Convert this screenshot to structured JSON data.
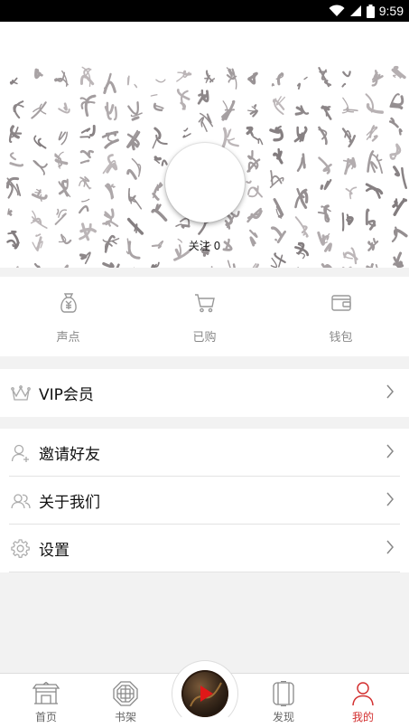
{
  "status_bar": {
    "time": "9:59",
    "icons": [
      "wifi-icon",
      "cell-signal-icon",
      "battery-icon"
    ]
  },
  "profile": {
    "follow_text": "关注 0"
  },
  "quick_menu": [
    {
      "label": "声点",
      "icon": "coin-bag-icon"
    },
    {
      "label": "已购",
      "icon": "cart-icon"
    },
    {
      "label": "钱包",
      "icon": "wallet-icon"
    }
  ],
  "vip_section": {
    "vip_label": "VIP会员",
    "icon": "crown-icon"
  },
  "menu": {
    "invite_label": "邀请好友",
    "about_label": "关于我们",
    "settings_label": "设置"
  },
  "bottom_nav": {
    "home": "首页",
    "bookshelf": "书架",
    "discover": "发现",
    "mine": "我的",
    "active": "mine"
  },
  "colors": {
    "accent": "#d32f2f",
    "icon_gray": "#999999",
    "background": "#f2f2f2"
  }
}
